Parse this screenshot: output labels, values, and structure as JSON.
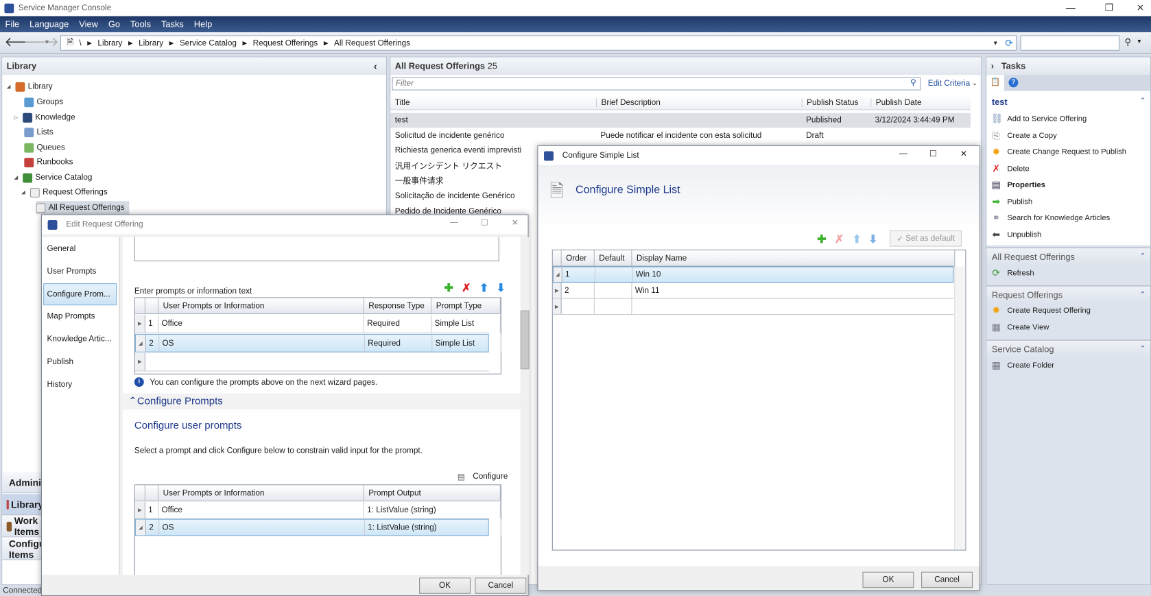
{
  "app": {
    "title": "Service Manager Console"
  },
  "menu": [
    "File",
    "Language",
    "View",
    "Go",
    "Tools",
    "Tasks",
    "Help"
  ],
  "breadcrumb": [
    "\\",
    "Library",
    "Library",
    "Service Catalog",
    "Request Offerings",
    "All Request Offerings"
  ],
  "library": {
    "title": "Library",
    "tree": [
      "Library",
      "Groups",
      "Knowledge",
      "Lists",
      "Queues",
      "Runbooks",
      "Service Catalog",
      "Request Offerings",
      "All Request Offerings"
    ],
    "wunderbar": [
      "Administration",
      "Library",
      "Work Items",
      "Configuration Items"
    ],
    "status": "Connected"
  },
  "main": {
    "title": "All Request Offerings",
    "count": "25",
    "filter_placeholder": "Filter",
    "edit_criteria": "Edit Criteria",
    "columns": [
      "Title",
      "Brief Description",
      "Publish Status",
      "Publish Date"
    ],
    "rows": [
      {
        "title": "test",
        "desc": "",
        "status": "Published",
        "date": "3/12/2024 3:44:49 PM"
      },
      {
        "title": "Solicitud de incidente genérico",
        "desc": "Puede notificar el incidente con esta solicitud",
        "status": "Draft",
        "date": ""
      },
      {
        "title": "Richiesta generica eventi imprevisti",
        "desc": "",
        "status": "",
        "date": ""
      },
      {
        "title": "汎用インシデント リクエスト",
        "desc": "",
        "status": "",
        "date": ""
      },
      {
        "title": "一般事件请求",
        "desc": "",
        "status": "",
        "date": ""
      },
      {
        "title": "Solicitação de incidente Genérico",
        "desc": "",
        "status": "",
        "date": ""
      },
      {
        "title": "Pedido de Incidente Genérico",
        "desc": "",
        "status": "",
        "date": ""
      }
    ]
  },
  "tasks": {
    "title": "Tasks",
    "selected": "test",
    "items": [
      "Add to Service Offering",
      "Create a Copy",
      "Create Change Request to Publish",
      "Delete",
      "Properties",
      "Publish",
      "Search for Knowledge Articles",
      "Unpublish"
    ],
    "sections": [
      {
        "title": "All Request Offerings",
        "items": [
          "Refresh"
        ]
      },
      {
        "title": "Request Offerings",
        "items": [
          "Create Request Offering",
          "Create View"
        ]
      },
      {
        "title": "Service Catalog",
        "items": [
          "Create Folder"
        ]
      }
    ]
  },
  "edit_dialog": {
    "title": "Edit Request Offering",
    "nav": [
      "General",
      "User Prompts",
      "Configure Prom...",
      "Map Prompts",
      "Knowledge Artic...",
      "Publish",
      "History"
    ],
    "prompts_label": "Enter prompts or information text",
    "prompt_columns": [
      "User Prompts or Information",
      "Response Type",
      "Prompt Type"
    ],
    "prompts": [
      {
        "n": "1",
        "name": "Office",
        "resp": "Required",
        "type": "Simple List"
      },
      {
        "n": "2",
        "name": "OS",
        "resp": "Required",
        "type": "Simple List"
      }
    ],
    "info": "You can configure the prompts above on the next wizard pages.",
    "section": "Configure Prompts",
    "subtitle": "Configure user prompts",
    "instructions": "Select a prompt and click Configure below to constrain valid input for the prompt.",
    "configure": "Configure",
    "output_columns": [
      "User Prompts or Information",
      "Prompt Output"
    ],
    "outputs": [
      {
        "n": "1",
        "name": "Office",
        "out": "1: ListValue (string)"
      },
      {
        "n": "2",
        "name": "OS",
        "out": "1: ListValue (string)"
      }
    ],
    "ok": "OK",
    "cancel": "Cancel"
  },
  "list_dialog": {
    "title": "Configure Simple List",
    "heading": "Configure Simple List",
    "set_default": "Set as default",
    "columns": [
      "Order",
      "Default",
      "Display Name"
    ],
    "rows": [
      {
        "order": "1",
        "default": "",
        "name": "Win 10"
      },
      {
        "order": "2",
        "default": "",
        "name": "Win 11"
      }
    ],
    "ok": "OK",
    "cancel": "Cancel"
  }
}
